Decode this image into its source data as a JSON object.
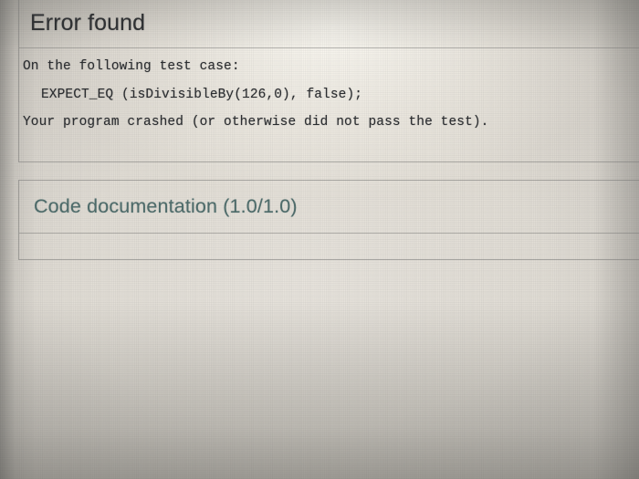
{
  "error_panel": {
    "title": "Error found",
    "lines": [
      "On the following test case:",
      "EXPECT_EQ (isDivisibleBy(126,0), false);",
      "Your program crashed (or otherwise did not pass the test)."
    ]
  },
  "doc_panel": {
    "title": "Code documentation (1.0/1.0)"
  },
  "colors": {
    "error_title": "#2f3133",
    "code_text": "#2b2d30",
    "doc_title": "#4e6b6a",
    "panel_border": "#767674",
    "page_background": "#e2ded6"
  }
}
